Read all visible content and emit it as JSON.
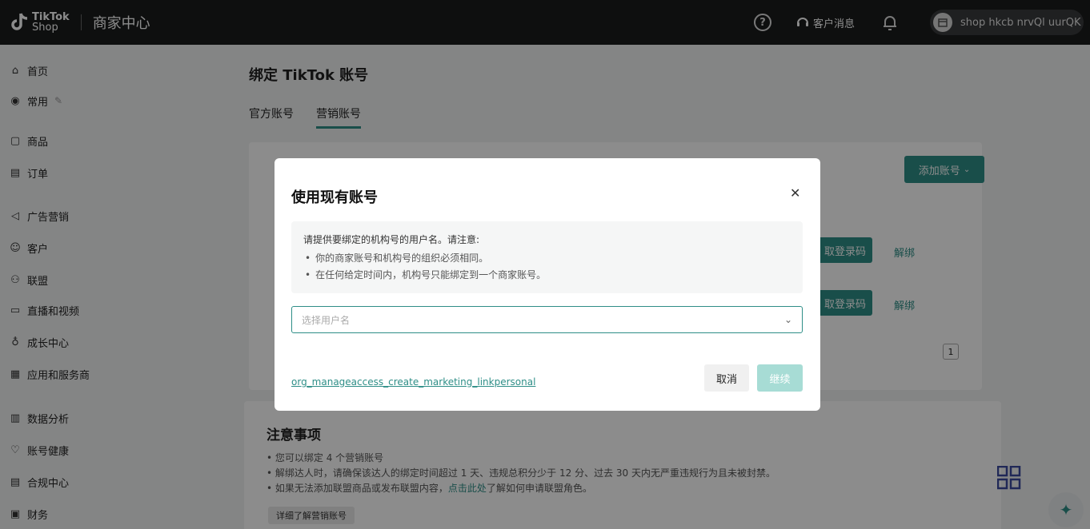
{
  "topbar": {
    "logo_line1": "TikTok",
    "logo_line2": "Shop",
    "section_title": "商家中心",
    "help_icon": "help-circle-icon",
    "messages_label": "客户消息",
    "shop_name": "shop hkcb nrvQl uurQK"
  },
  "sidebar": {
    "items": [
      {
        "label": "首页",
        "icon": "home-icon"
      },
      {
        "label": "常用",
        "icon": "star-icon"
      },
      {
        "label": "商品",
        "icon": "box-icon"
      },
      {
        "label": "订单",
        "icon": "clipboard-icon"
      },
      {
        "label": "广告营销",
        "icon": "megaphone-icon"
      },
      {
        "label": "客户",
        "icon": "users-icon"
      },
      {
        "label": "联盟",
        "icon": "people-icon"
      },
      {
        "label": "直播和视频",
        "icon": "video-icon"
      },
      {
        "label": "成长中心",
        "icon": "medal-icon"
      },
      {
        "label": "应用和服务商",
        "icon": "apps-icon"
      },
      {
        "label": "数据分析",
        "icon": "chart-icon"
      },
      {
        "label": "账号健康",
        "icon": "heart-icon"
      },
      {
        "label": "合规中心",
        "icon": "document-icon"
      },
      {
        "label": "财务",
        "icon": "finance-icon"
      }
    ]
  },
  "main": {
    "page_title": "绑定 TikTok 账号",
    "tabs": [
      {
        "label": "官方账号"
      },
      {
        "label": "营销账号"
      }
    ],
    "add_account_label": "添加账号",
    "row_button_label": "取登录码",
    "unbind_label": "解绑",
    "page_number": "1",
    "notes": {
      "title": "注意事项",
      "line1": "您可以绑定 4 个营销账号",
      "line2": "解绑达人时，请确保该达人的绑定时间超过 1 天、违规总积分少于 12 分、过去 30 天内无严重违规行为且未被封禁。",
      "line3_prefix": "如果无法添加联盟商品或发布联盟内容，",
      "line3_link": "点击此处",
      "line3_suffix": "了解如何申请联盟角色。",
      "learn_more": "详细了解营销账号"
    }
  },
  "modal": {
    "title": "使用现有账号",
    "notice_heading": "请提供要绑定的机构号的用户名。请注意:",
    "notice_bullet1": "你的商家账号和机构号的组织必须相同。",
    "notice_bullet2": "在任何给定时间内，机构号只能绑定到一个商家账号。",
    "select_placeholder": "选择用户名",
    "link_text": "org_manageaccess_create_marketing_linkpersonal",
    "cancel_label": "取消",
    "continue_label": "继续"
  },
  "colors": {
    "accent": "#2e8e87",
    "accent_disabled": "#a7dcd5",
    "topbar_bg": "#1b1c1d"
  }
}
